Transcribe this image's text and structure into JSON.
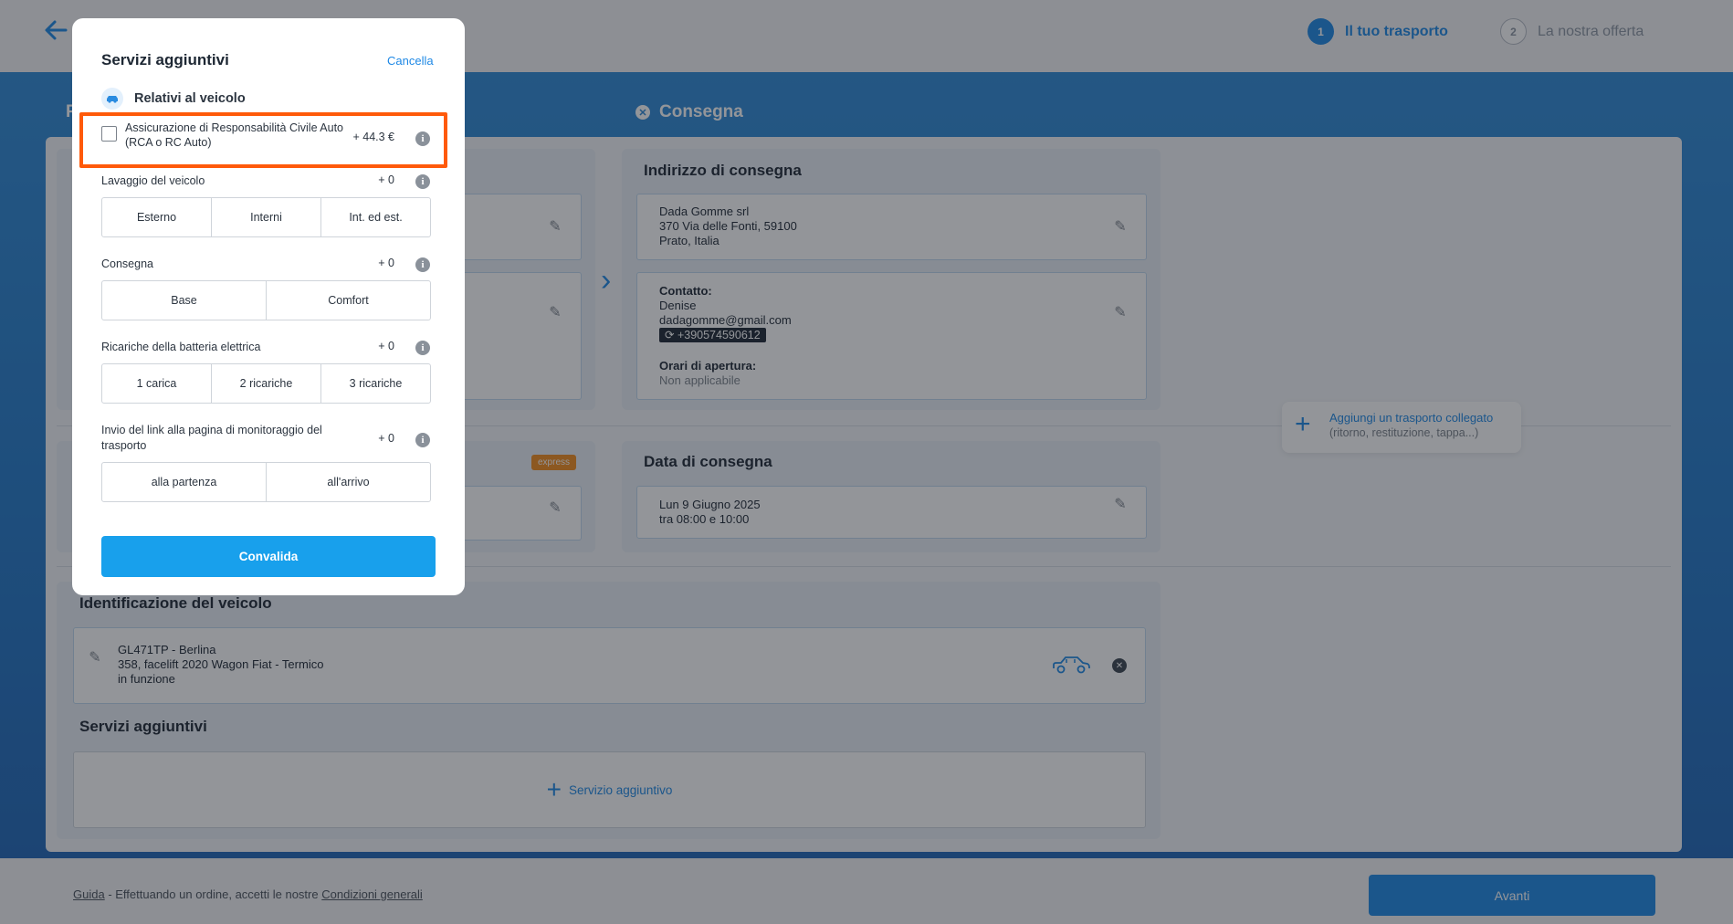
{
  "header": {
    "steps": [
      {
        "num": "1",
        "label": "Il tuo trasporto"
      },
      {
        "num": "2",
        "label": "La nostra offerta"
      }
    ]
  },
  "band": {
    "left_title_initial": "P",
    "delivery_title": "Consegna"
  },
  "delivery_address": {
    "title": "Indirizzo di consegna",
    "line1": "Dada Gomme srl",
    "line2": "370 Via delle Fonti, 59100",
    "line3": "Prato, Italia",
    "contact_label": "Contatto:",
    "contact_name": "Denise",
    "contact_email": "dadagomme@gmail.com",
    "contact_phone": "+390574590612",
    "hours_label": "Orari di apertura:",
    "hours_value": "Non applicabile"
  },
  "delivery_date": {
    "title": "Data di consegna",
    "date": "Lun 9 Giugno 2025",
    "time": "tra 08:00 e 10:00"
  },
  "express_badge": "express",
  "linked_transport": {
    "title": "Aggiungi un trasporto collegato",
    "subtitle": "(ritorno, restituzione, tappa...)"
  },
  "vehicle": {
    "title": "Identificazione del veicolo",
    "line1": "GL471TP - Berlina",
    "line2": "358, facelift 2020 Wagon Fiat - Termico",
    "line3": "in funzione"
  },
  "additional_services": {
    "title": "Servizi aggiuntivi",
    "add_label": "Servizio aggiuntivo"
  },
  "footer": {
    "guide": "Guida",
    "middle": " - Effettuando un ordine, accetti le nostre ",
    "terms": "Condizioni generali",
    "next_button": "Avanti"
  },
  "modal": {
    "title": "Servizi aggiuntivi",
    "cancel": "Cancella",
    "section": "Relativi al veicolo",
    "insurance": {
      "label": "Assicurazione di Responsabilità Civile Auto (RCA o RC Auto)",
      "price": "+ 44.3 €"
    },
    "options": [
      {
        "label": "Lavaggio del veicolo",
        "price": "+ 0",
        "choices": [
          "Esterno",
          "Interni",
          "Int. ed est."
        ]
      },
      {
        "label": "Consegna",
        "price": "+ 0",
        "choices": [
          "Base",
          "Comfort"
        ]
      },
      {
        "label": "Ricariche della batteria elettrica",
        "price": "+ 0",
        "choices": [
          "1 carica",
          "2 ricariche",
          "3 ricariche"
        ]
      },
      {
        "label": "Invio del link alla pagina di monitoraggio del trasporto",
        "price": "+ 0",
        "choices": [
          "alla partenza",
          "all'arrivo"
        ]
      }
    ],
    "submit": "Convalida"
  },
  "colors": {
    "accent": "#1e88e5",
    "band": "#2279c9",
    "highlight": "#ff5a0a",
    "express": "#f28c1e",
    "submit": "#18a0ec"
  }
}
